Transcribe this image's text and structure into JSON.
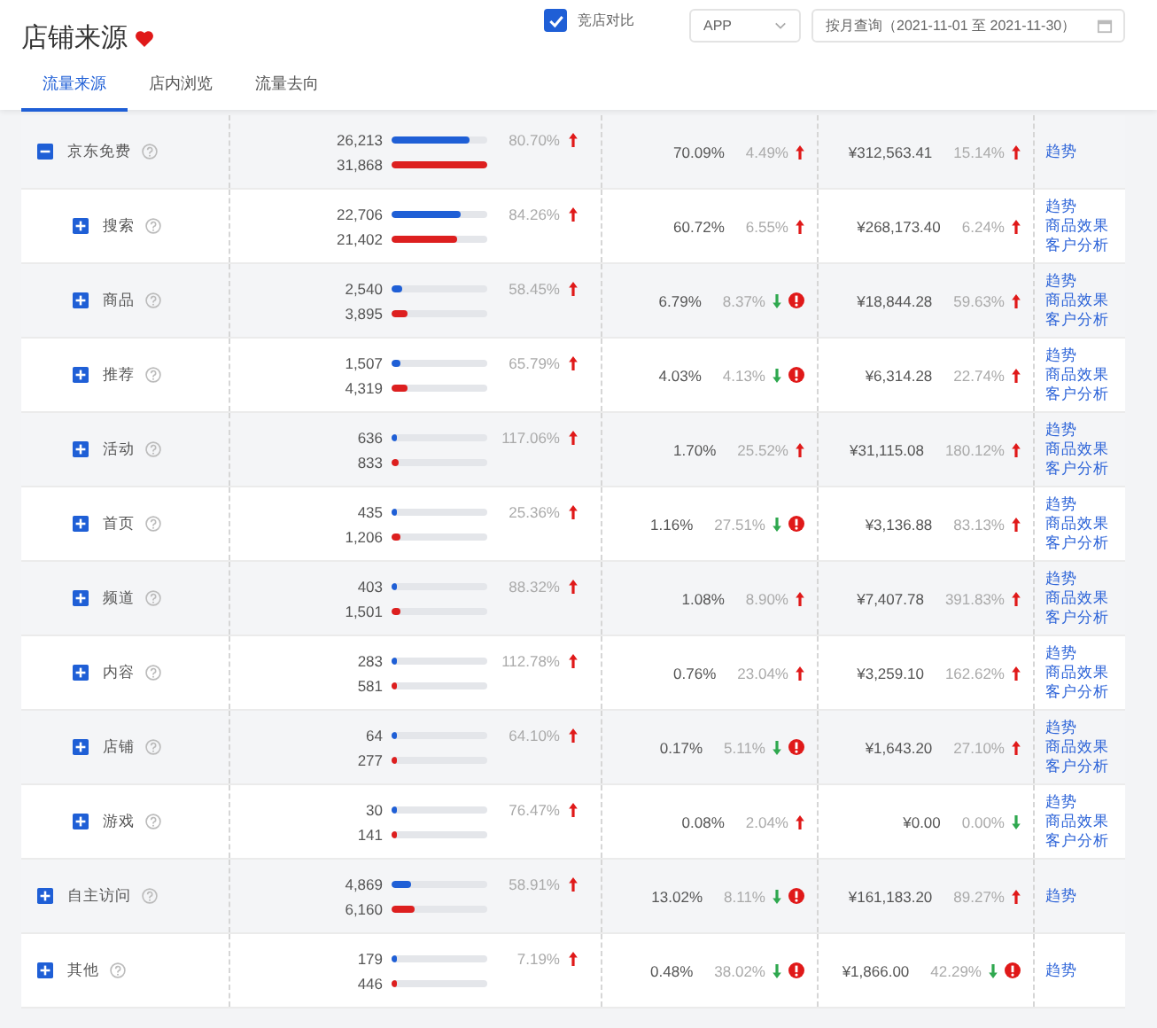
{
  "title": "店铺来源",
  "compare": {
    "label": "竞店对比",
    "checked": true
  },
  "platform_select": {
    "value": "APP"
  },
  "date_field": {
    "value": "按月查询（2021-11-01 至 2021-11-30）"
  },
  "tabs": [
    {
      "label": "流量来源",
      "selected": true
    },
    {
      "label": "店内浏览",
      "selected": false
    },
    {
      "label": "流量去向",
      "selected": false
    }
  ],
  "rows": [
    {
      "name": "京东免费",
      "expanded": true,
      "bars": [
        {
          "value": "26,213",
          "level": 0.82,
          "color": "#1f5fd6"
        },
        {
          "value": "31,868",
          "level": 1.0,
          "color": "#dd1f1f"
        }
      ],
      "change": "80.70%",
      "rising": true,
      "conversion": {
        "value": "70.09%",
        "change": "4.49%",
        "rising": true,
        "alert": false
      },
      "sales": {
        "value": "¥312,563.41",
        "change": "15.14%",
        "rising": true,
        "alert": false
      },
      "links": [
        "趋势"
      ],
      "children": [
        {
          "name": "搜索",
          "expanded": false,
          "bars": [
            {
              "value": "22,706",
              "level": 0.73,
              "color": "#1f5fd6"
            },
            {
              "value": "21,402",
              "level": 0.69,
              "color": "#dd1f1f"
            }
          ],
          "change": "84.26%",
          "rising": true,
          "conversion": {
            "value": "60.72%",
            "change": "6.55%",
            "rising": true,
            "alert": false
          },
          "sales": {
            "value": "¥268,173.40",
            "change": "6.24%",
            "rising": true,
            "alert": false
          },
          "links": [
            "趋势",
            "商品效果",
            "客户分析"
          ]
        },
        {
          "name": "商品",
          "expanded": false,
          "bars": [
            {
              "value": "2,540",
              "level": 0.12,
              "color": "#1f5fd6"
            },
            {
              "value": "3,895",
              "level": 0.16,
              "color": "#dd1f1f"
            }
          ],
          "change": "58.45%",
          "rising": true,
          "conversion": {
            "value": "6.79%",
            "change": "8.37%",
            "rising": false,
            "alert": true
          },
          "sales": {
            "value": "¥18,844.28",
            "change": "59.63%",
            "rising": true,
            "alert": false
          },
          "links": [
            "趋势",
            "商品效果",
            "客户分析"
          ]
        },
        {
          "name": "推荐",
          "expanded": false,
          "bars": [
            {
              "value": "1,507",
              "level": 0.09,
              "color": "#1f5fd6"
            },
            {
              "value": "4,319",
              "level": 0.17,
              "color": "#dd1f1f"
            }
          ],
          "change": "65.79%",
          "rising": true,
          "conversion": {
            "value": "4.03%",
            "change": "4.13%",
            "rising": false,
            "alert": true
          },
          "sales": {
            "value": "¥6,314.28",
            "change": "22.74%",
            "rising": true,
            "alert": false
          },
          "links": [
            "趋势",
            "商品效果",
            "客户分析"
          ]
        },
        {
          "name": "活动",
          "expanded": false,
          "bars": [
            {
              "value": "636",
              "level": 0.06,
              "color": "#1f5fd6"
            },
            {
              "value": "833",
              "level": 0.07,
              "color": "#dd1f1f"
            }
          ],
          "change": "117.06%",
          "rising": true,
          "conversion": {
            "value": "1.70%",
            "change": "25.52%",
            "rising": true,
            "alert": false
          },
          "sales": {
            "value": "¥31,115.08",
            "change": "180.12%",
            "rising": true,
            "alert": false
          },
          "links": [
            "趋势",
            "商品效果",
            "客户分析"
          ]
        },
        {
          "name": "首页",
          "expanded": false,
          "bars": [
            {
              "value": "435",
              "level": 0.06,
              "color": "#1f5fd6"
            },
            {
              "value": "1,206",
              "level": 0.09,
              "color": "#dd1f1f"
            }
          ],
          "change": "25.36%",
          "rising": true,
          "conversion": {
            "value": "1.16%",
            "change": "27.51%",
            "rising": false,
            "alert": true
          },
          "sales": {
            "value": "¥3,136.88",
            "change": "83.13%",
            "rising": true,
            "alert": false
          },
          "links": [
            "趋势",
            "商品效果",
            "客户分析"
          ]
        },
        {
          "name": "频道",
          "expanded": false,
          "bars": [
            {
              "value": "403",
              "level": 0.06,
              "color": "#1f5fd6"
            },
            {
              "value": "1,501",
              "level": 0.1,
              "color": "#dd1f1f"
            }
          ],
          "change": "88.32%",
          "rising": true,
          "conversion": {
            "value": "1.08%",
            "change": "8.90%",
            "rising": true,
            "alert": false
          },
          "sales": {
            "value": "¥7,407.78",
            "change": "391.83%",
            "rising": true,
            "alert": false
          },
          "links": [
            "趋势",
            "商品效果",
            "客户分析"
          ]
        },
        {
          "name": "内容",
          "expanded": false,
          "bars": [
            {
              "value": "283",
              "level": 0.05,
              "color": "#1f5fd6"
            },
            {
              "value": "581",
              "level": 0.06,
              "color": "#dd1f1f"
            }
          ],
          "change": "112.78%",
          "rising": true,
          "conversion": {
            "value": "0.76%",
            "change": "23.04%",
            "rising": true,
            "alert": false
          },
          "sales": {
            "value": "¥3,259.10",
            "change": "162.62%",
            "rising": true,
            "alert": false
          },
          "links": [
            "趋势",
            "商品效果",
            "客户分析"
          ]
        },
        {
          "name": "店铺",
          "expanded": false,
          "bars": [
            {
              "value": "64",
              "level": 0.03,
              "color": "#1f5fd6"
            },
            {
              "value": "277",
              "level": 0.05,
              "color": "#dd1f1f"
            }
          ],
          "change": "64.10%",
          "rising": true,
          "conversion": {
            "value": "0.17%",
            "change": "5.11%",
            "rising": false,
            "alert": true
          },
          "sales": {
            "value": "¥1,643.20",
            "change": "27.10%",
            "rising": true,
            "alert": false
          },
          "links": [
            "趋势",
            "商品效果",
            "客户分析"
          ]
        },
        {
          "name": "游戏",
          "expanded": false,
          "bars": [
            {
              "value": "30",
              "level": 0.03,
              "color": "#1f5fd6"
            },
            {
              "value": "141",
              "level": 0.04,
              "color": "#dd1f1f"
            }
          ],
          "change": "76.47%",
          "rising": true,
          "conversion": {
            "value": "0.08%",
            "change": "2.04%",
            "rising": true,
            "alert": false
          },
          "sales": {
            "value": "¥0.00",
            "change": "0.00%",
            "rising": false,
            "alert": false
          },
          "links": [
            "趋势",
            "商品效果",
            "客户分析"
          ]
        }
      ]
    },
    {
      "name": "自主访问",
      "expanded": false,
      "bars": [
        {
          "value": "4,869",
          "level": 0.2,
          "color": "#1f5fd6"
        },
        {
          "value": "6,160",
          "level": 0.24,
          "color": "#dd1f1f"
        }
      ],
      "change": "58.91%",
      "rising": true,
      "conversion": {
        "value": "13.02%",
        "change": "8.11%",
        "rising": false,
        "alert": true
      },
      "sales": {
        "value": "¥161,183.20",
        "change": "89.27%",
        "rising": true,
        "alert": false
      },
      "links": [
        "趋势"
      ]
    },
    {
      "name": "其他",
      "expanded": false,
      "bars": [
        {
          "value": "179",
          "level": 0.04,
          "color": "#1f5fd6"
        },
        {
          "value": "446",
          "level": 0.06,
          "color": "#dd1f1f"
        }
      ],
      "change": "7.19%",
      "rising": true,
      "conversion": {
        "value": "0.48%",
        "change": "38.02%",
        "rising": false,
        "alert": true
      },
      "sales": {
        "value": "¥1,866.00",
        "change": "42.29%",
        "rising": false,
        "alert": true
      },
      "links": [
        "趋势"
      ]
    }
  ]
}
